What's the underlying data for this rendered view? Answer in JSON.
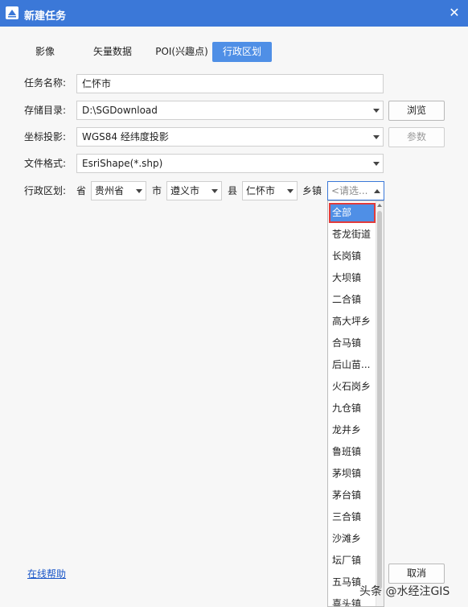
{
  "window": {
    "title": "新建任务",
    "close_glyph": "✕"
  },
  "tabs": [
    {
      "label": "影像",
      "active": false
    },
    {
      "label": "矢量数据",
      "active": false
    },
    {
      "label": "POI(兴趣点)",
      "active": false
    },
    {
      "label": "行政区划",
      "active": true
    }
  ],
  "form": {
    "task_name": {
      "label": "任务名称:",
      "value": "仁怀市"
    },
    "storage_dir": {
      "label": "存储目录:",
      "value": "D:\\SGDownload",
      "button": "浏览"
    },
    "projection": {
      "label": "坐标投影:",
      "value": "WGS84 经纬度投影",
      "button": "参数",
      "button_disabled": true
    },
    "file_format": {
      "label": "文件格式:",
      "value": "EsriShape(*.shp)"
    },
    "region": {
      "label": "行政区划:",
      "province_label": "省",
      "province_value": "贵州省",
      "city_label": "市",
      "city_value": "遵义市",
      "county_label": "县",
      "county_value": "仁怀市",
      "town_label": "乡镇",
      "town_value": "<请选..."
    }
  },
  "town_dropdown": {
    "items": [
      "全部",
      "苍龙街道",
      "长岗镇",
      "大坝镇",
      "二合镇",
      "高大坪乡",
      "合马镇",
      "后山苗...",
      "火石岗乡",
      "九仓镇",
      "龙井乡",
      "鲁班镇",
      "茅坝镇",
      "茅台镇",
      "三合镇",
      "沙滩乡",
      "坛厂镇",
      "五马镇",
      "喜头镇"
    ],
    "selected_index": 0
  },
  "footer": {
    "help_link": "在线帮助",
    "cancel_button": "取消"
  },
  "watermark": "头条 @水经注GIS",
  "colors": {
    "titlebar": "#3b78d8",
    "accent": "#4f8fe6",
    "selection_outline": "#e23b3b",
    "link": "#1a56c8"
  }
}
